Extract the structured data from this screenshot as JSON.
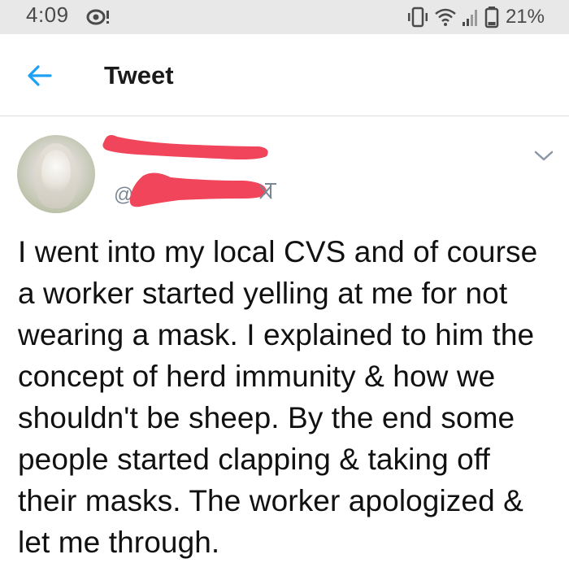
{
  "status_bar": {
    "time": "4:09",
    "battery": "21%",
    "icons": [
      "notification-icon",
      "vibrate-icon",
      "wifi-icon",
      "signal-icon",
      "battery-icon"
    ]
  },
  "header": {
    "title": "Tweet",
    "back_icon": "back-arrow-icon"
  },
  "tweet": {
    "handle_prefix": "@",
    "menu_icon": "chevron-down-icon",
    "text": "I went into my local CVS and of course a worker started yelling at me for not wearing a mask. I explained to him the concept of herd immunity & how we shouldn't be sheep. By the end some people started clapping & taking off their masks. The worker apologized & let me through."
  },
  "colors": {
    "accent": "#1da1f2",
    "redaction": "#f0455a",
    "status_bar_bg": "#e8e8e8",
    "handle": "#7a8794"
  }
}
